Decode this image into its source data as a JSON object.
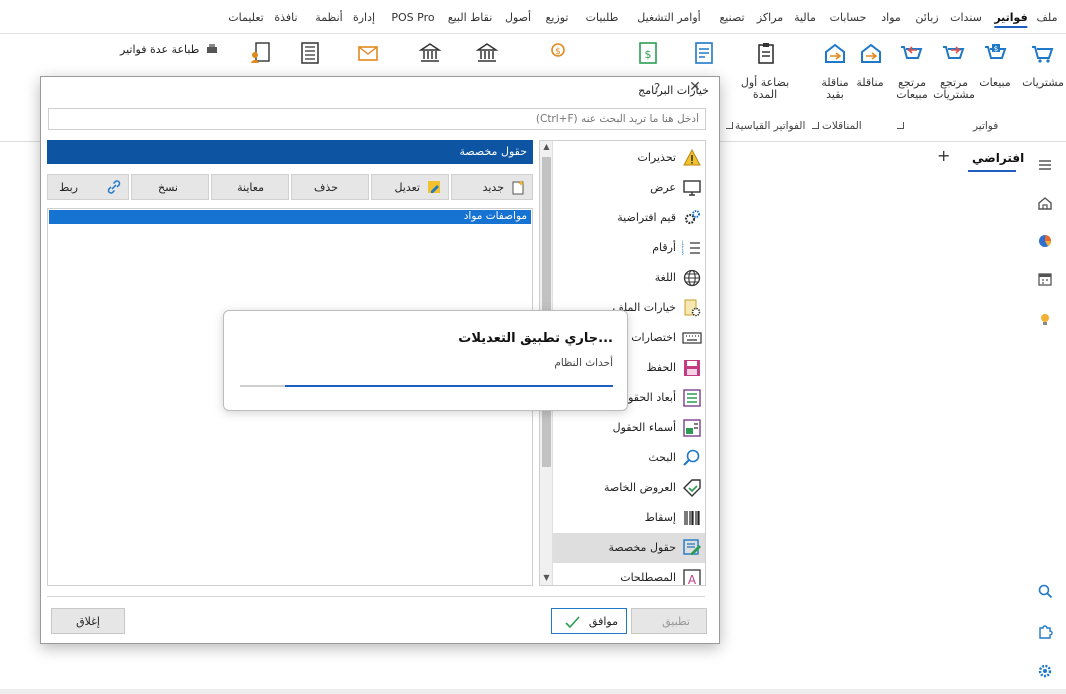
{
  "menu": {
    "items": [
      {
        "label": "ملف",
        "active": false
      },
      {
        "label": "فواتير",
        "active": true
      },
      {
        "label": "سندات",
        "active": false
      },
      {
        "label": "زبائن",
        "active": false
      },
      {
        "label": "مواد",
        "active": false
      },
      {
        "label": "حسابات",
        "active": false
      },
      {
        "label": "مالية",
        "active": false
      },
      {
        "label": "مراكز",
        "active": false
      },
      {
        "label": "تصنيع",
        "active": false
      },
      {
        "label": "أوامر التشغيل",
        "active": false
      },
      {
        "label": "طلبيات",
        "active": false
      },
      {
        "label": "توزيع",
        "active": false
      },
      {
        "label": "أصول",
        "active": false
      },
      {
        "label": "نقاط البيع",
        "active": false
      },
      {
        "label": "POS Pro",
        "active": false
      },
      {
        "label": "إدارة",
        "active": false
      },
      {
        "label": "أنظمة",
        "active": false
      },
      {
        "label": "نافذة",
        "active": false
      },
      {
        "label": "تعليمات",
        "active": false
      }
    ]
  },
  "ribbon": {
    "buttons": {
      "purchases": "مشتريات",
      "sales": "مبيعات",
      "purchase_returns_line1": "مرتجع",
      "purchase_returns_line2": "مشتريات",
      "sales_returns_line1": "مرتجع",
      "sales_returns_line2": "مبيعات",
      "transfer": "مناقلة",
      "transfer_restricted_line1": "مناقلة",
      "transfer_restricted_line2": "بقيد",
      "opening_goods_line1": "بضاعة أول",
      "opening_goods_line2": "المدة",
      "print_multiple": "طباعة عدة فواتير"
    },
    "groups": {
      "invoices": "فواتير",
      "transfers": "المناقلات",
      "standard_invoices": "الفواتير القياسية"
    }
  },
  "tabs": {
    "active_label": "افتراضي",
    "add_symbol": "+"
  },
  "dialog": {
    "title": "خيارات البرنامج",
    "help_symbol": "?",
    "close_symbol": "✕",
    "search_placeholder": "أدخل هنا ما تريد البحث عنه (Ctrl+F)",
    "categories": [
      {
        "label": "تحذيرات",
        "icon": "warning-icon",
        "selected": false
      },
      {
        "label": "عرض",
        "icon": "monitor-icon",
        "selected": false
      },
      {
        "label": "قيم افتراضية",
        "icon": "gears-icon",
        "selected": false
      },
      {
        "label": "أرقام",
        "icon": "numbered-list-icon",
        "selected": false
      },
      {
        "label": "اللغة",
        "icon": "globe-icon",
        "selected": false
      },
      {
        "label": "خيارات الملف",
        "icon": "file-settings-icon",
        "selected": false
      },
      {
        "label": "اختصارات",
        "icon": "keyboard-icon",
        "selected": false
      },
      {
        "label": "الحفظ",
        "icon": "save-icon",
        "selected": false
      },
      {
        "label": "أبعاد الحقول",
        "icon": "field-dimensions-icon",
        "selected": false
      },
      {
        "label": "أسماء الحقول",
        "icon": "field-names-icon",
        "selected": false
      },
      {
        "label": "البحث",
        "icon": "search-icon",
        "selected": false
      },
      {
        "label": "العروض الخاصة",
        "icon": "tag-icon",
        "selected": false
      },
      {
        "label": "إسقاط",
        "icon": "barcode-icon",
        "selected": false
      },
      {
        "label": "حقول مخصصة",
        "icon": "custom-fields-icon",
        "selected": true
      },
      {
        "label": "المصطلحات",
        "icon": "terms-icon",
        "selected": false
      }
    ],
    "panel_header": "حقول مخصصة",
    "toolbar": {
      "new": "جديد",
      "edit": "تعديل",
      "delete": "حذف",
      "preview": "معاينة",
      "copy": "نسخ",
      "link": "ربط"
    },
    "list_rows": [
      "مواصفات مواد"
    ],
    "buttons": {
      "apply": "تطبيق",
      "ok": "موافق",
      "close": "إغلاق"
    }
  },
  "progress": {
    "title": "جاري تطبيق التعديلات...",
    "status": "أحداث النظام",
    "fraction": 0.88
  },
  "colors": {
    "accent": "#1f5fbf",
    "panel_header": "#0d55a3",
    "selected_row": "#1673d1"
  }
}
